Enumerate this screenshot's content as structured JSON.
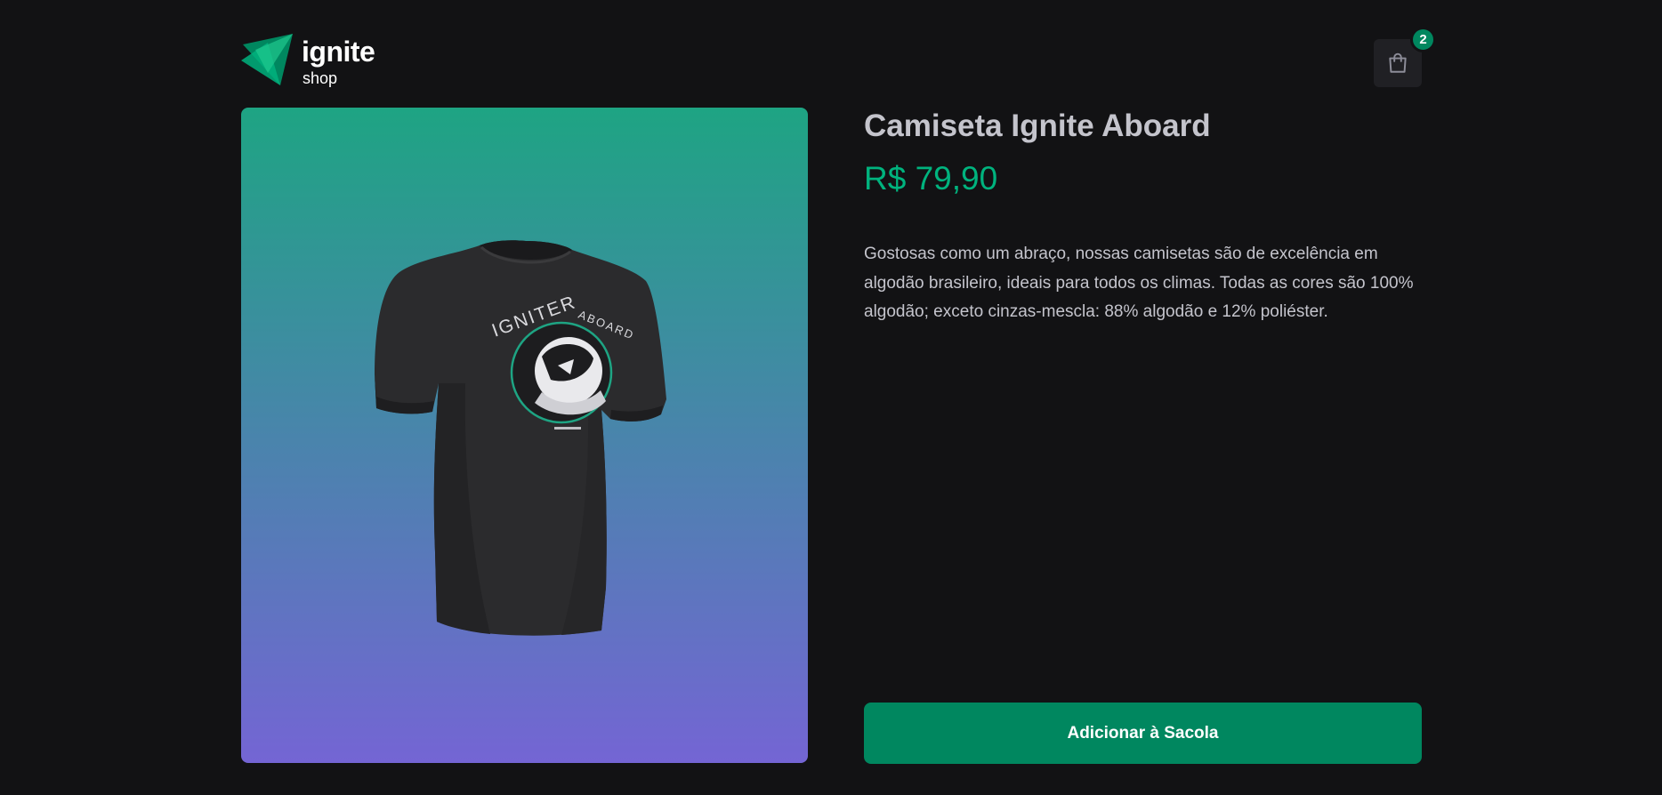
{
  "header": {
    "logo_title": "ignite",
    "logo_subtitle": "shop",
    "cart_count": "2",
    "cart_icon": "shopping-bag-icon"
  },
  "product": {
    "title": "Camiseta Ignite Aboard",
    "price": "R$ 79,90",
    "description": "Gostosas como um abraço, nossas camisetas são de excelência em algodão brasileiro, ideais para todos os climas. Todas as cores são 100% algodão; exceto cinzas-mescla: 88% algodão e 12% poliéster.",
    "image_alt": "Camiseta Ignite Aboard",
    "image_print_text": [
      "IGNITER",
      "ABOARD"
    ],
    "buy_label": "Adicionar à Sacola"
  },
  "colors": {
    "background": "#121214",
    "accent": "#00875f",
    "price": "#00b37e",
    "gradient_top": "#1ea483",
    "gradient_bottom": "#7465d4"
  }
}
